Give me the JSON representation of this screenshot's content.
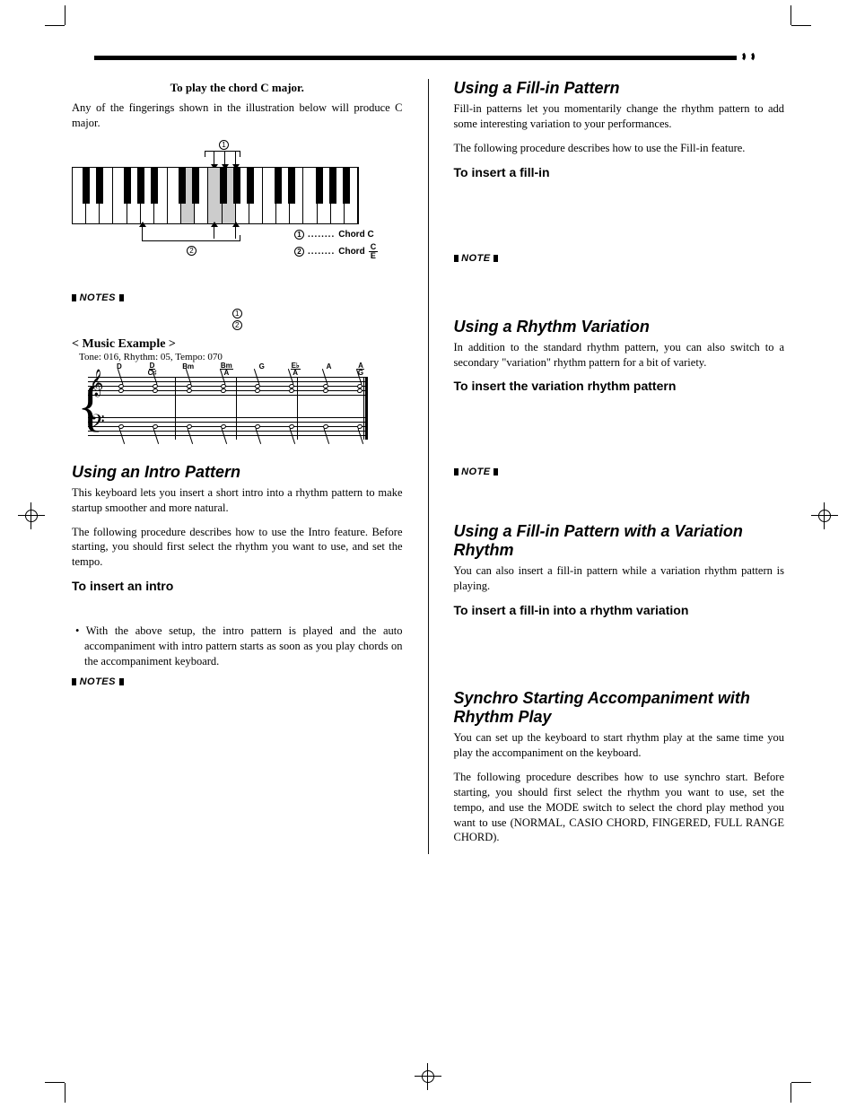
{
  "left": {
    "ex_title": "To play the chord C major.",
    "ex_body": "Any of the fingerings shown in the illustration below will produce C major.",
    "legend": {
      "dots": "........",
      "chord1": "Chord C",
      "chord2_prefix": "Chord",
      "chord2_num": "C",
      "chord2_den": "E"
    },
    "notes_label": "NOTES",
    "music_ex": "< Music Example >",
    "music_sub": "Tone: 016, Rhythm: 05, Tempo: 070",
    "chords": [
      "D",
      "D/C♯",
      "Bm",
      "Bm/A",
      "G",
      "E♭/A",
      "A",
      "A/G"
    ],
    "sec1_h": "Using an Intro Pattern",
    "sec1_p1": "This keyboard lets you insert a short intro into a rhythm pattern to make startup smoother and more natural.",
    "sec1_p2": "The following procedure describes how to use the Intro feature. Before starting, you should first select the rhythm you want to use, and set the tempo.",
    "sec1_sub": "To insert an intro",
    "sec1_bullet": "With the above setup, the intro pattern is played and the auto accompaniment with intro pattern starts as soon as you play chords on the accompaniment keyboard.",
    "notes_label2": "NOTES"
  },
  "right": {
    "sec1_h": "Using a Fill-in Pattern",
    "sec1_p1": "Fill-in patterns let you momentarily change the rhythm pattern to add some interesting variation to your performances.",
    "sec1_p2": "The following procedure describes how to use the Fill-in feature.",
    "sec1_sub": "To insert a fill-in",
    "note_label": "NOTE",
    "sec2_h": "Using a Rhythm Variation",
    "sec2_p1": "In addition to the standard rhythm pattern, you can also switch to a secondary \"variation\" rhythm pattern for a bit of variety.",
    "sec2_sub": "To insert the variation rhythm pattern",
    "sec3_h": "Using a Fill-in Pattern with a Variation Rhythm",
    "sec3_p1": "You can also insert a fill-in pattern while a variation rhythm pattern is playing.",
    "sec3_sub": "To insert a fill-in into a rhythm variation",
    "sec4_h": "Synchro Starting Accompaniment with Rhythm Play",
    "sec4_p1": "You can set up the keyboard to start rhythm play at the same time you play the accompaniment on the keyboard.",
    "sec4_p2": "The following procedure describes how to use synchro start. Before starting, you should first select the rhythm you want to use, set the tempo, and use the MODE switch to select the chord play method you want to use (NORMAL, CASIO CHORD, FINGERED, FULL RANGE CHORD)."
  }
}
